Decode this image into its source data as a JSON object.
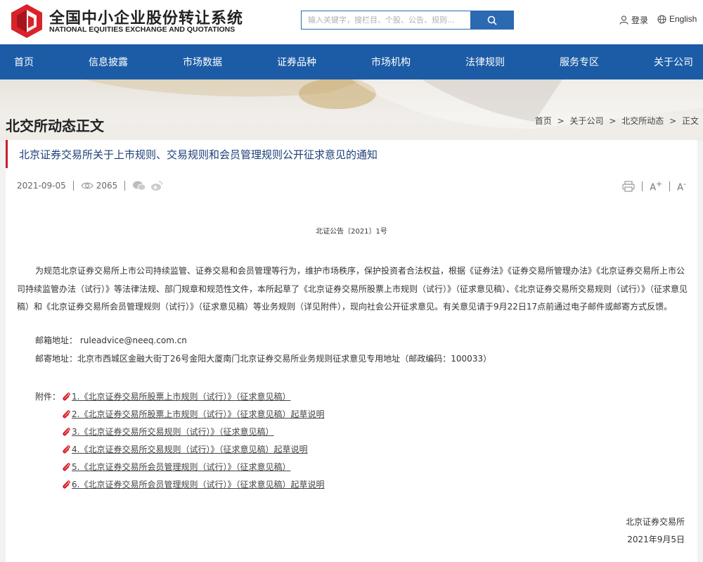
{
  "brand": {
    "name_cn": "全国中小企业股份转让系统",
    "name_en": "NATIONAL EQUITIES EXCHANGE AND QUOTATIONS",
    "color": "#d9222a"
  },
  "search": {
    "placeholder": "输入关键字，搜栏目、个股、公告、规则..."
  },
  "header": {
    "login": "登录",
    "english": "English"
  },
  "nav": [
    "首页",
    "信息披露",
    "市场数据",
    "证券品种",
    "市场机构",
    "法律规则",
    "服务专区",
    "关于公司"
  ],
  "banner": {
    "title": "北交所动态正文",
    "breadcrumb": [
      "首页",
      "关于公司",
      "北交所动态",
      "正文"
    ],
    "separator": ">"
  },
  "article": {
    "title": "北京证券交易所关于上市规则、交易规则和会员管理规则公开征求意见的通知",
    "date": "2021-09-05",
    "views": "2065",
    "font_up": "A",
    "font_down": "A",
    "doc_no": "北证公告〔2021〕1号",
    "body": "为规范北京证券交易所上市公司持续监管、证券交易和会员管理等行为，维护市场秩序，保护投资者合法权益，根据《证券法》《证券交易所管理办法》《北京证券交易所上市公司持续监管办法（试行）》等法律法规、部门规章和规范性文件，本所起草了《北京证券交易所股票上市规则（试行）》（征求意见稿）、《北京证券交易所交易规则（试行）》（征求意见稿）和《北京证券交易所会员管理规则（试行）》（征求意见稿）等业务规则（详见附件），现向社会公开征求意见。有关意见请于9月22日17点前通过电子邮件或邮寄方式反馈。",
    "email_line": "邮箱地址： ruleadvice@neeq.com.cn",
    "mail_line": "邮寄地址：北京市西城区金融大街丁26号金阳大厦南门北京证券交易所业务规则征求意见专用地址（邮政编码：100033）",
    "attach_label": "附件：",
    "attachments": [
      "1.《北京证券交易所股票上市规则（试行）》（征求意见稿）",
      "2.《北京证券交易所股票上市规则（试行）》（征求意见稿）起草说明",
      "3.《北京证券交易所交易规则（试行）》（征求意见稿）",
      "4.《北京证券交易所交易规则（试行）》（征求意见稿）起草说明",
      "5.《北京证券交易所会员管理规则（试行）》（征求意见稿）",
      "6.《北京证券交易所会员管理规则（试行）》（征求意见稿）起草说明"
    ],
    "signature": "北京证券交易所",
    "sign_date": "2021年9月5日"
  },
  "colors": {
    "nav": "#1c5ca6",
    "accent": "#c8202b",
    "title": "#1c3f78"
  }
}
